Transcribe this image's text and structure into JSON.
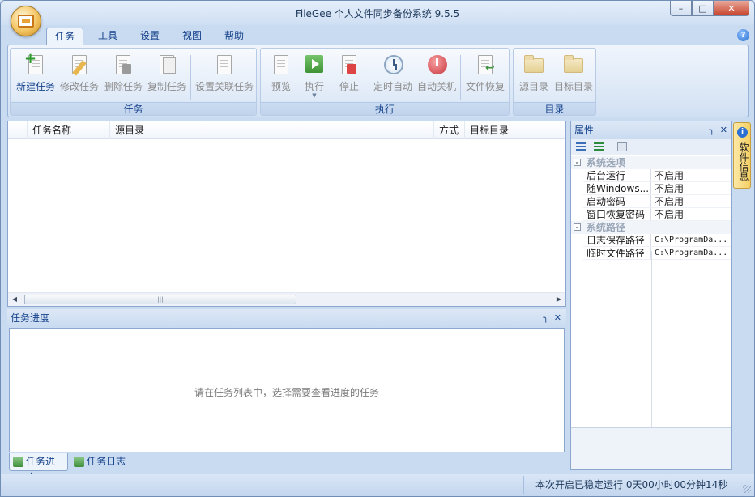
{
  "window": {
    "title": "FileGee 个人文件同步备份系统 9.5.5"
  },
  "ribbon_tabs": [
    "任务",
    "工具",
    "设置",
    "视图",
    "帮助"
  ],
  "ribbon": {
    "groups": [
      {
        "label": "任务",
        "buttons": [
          "新建任务",
          "修改任务",
          "删除任务",
          "复制任务",
          "设置关联任务"
        ]
      },
      {
        "label": "执行",
        "buttons": [
          "预览",
          "执行",
          "停止",
          "定时自动",
          "自动关机",
          "文件恢复"
        ]
      },
      {
        "label": "目录",
        "buttons": [
          "源目录",
          "目标目录"
        ]
      }
    ]
  },
  "task_list": {
    "columns": [
      "任务名称",
      "源目录",
      "方式",
      "目标目录"
    ],
    "rows": []
  },
  "progress": {
    "title": "任务进度",
    "hint": "请在任务列表中，选择需要查看进度的任务"
  },
  "bottom_tabs": [
    "任务进度",
    "任务日志"
  ],
  "properties": {
    "title": "属性",
    "categories": [
      {
        "name": "系统选项",
        "rows": [
          {
            "name": "后台运行",
            "value": "不启用"
          },
          {
            "name": "随Windows...",
            "value": "不启用"
          },
          {
            "name": "启动密码",
            "value": "不启用"
          },
          {
            "name": "窗口恢复密码",
            "value": "不启用"
          }
        ]
      },
      {
        "name": "系统路径",
        "rows": [
          {
            "name": "日志保存路径",
            "value": "C:\\ProgramDa..."
          },
          {
            "name": "临时文件路径",
            "value": "C:\\ProgramDa..."
          }
        ]
      }
    ]
  },
  "side_tab": {
    "label": "软件信息"
  },
  "status": {
    "text": "本次开启已稳定运行 0天00小时00分钟14秒"
  }
}
